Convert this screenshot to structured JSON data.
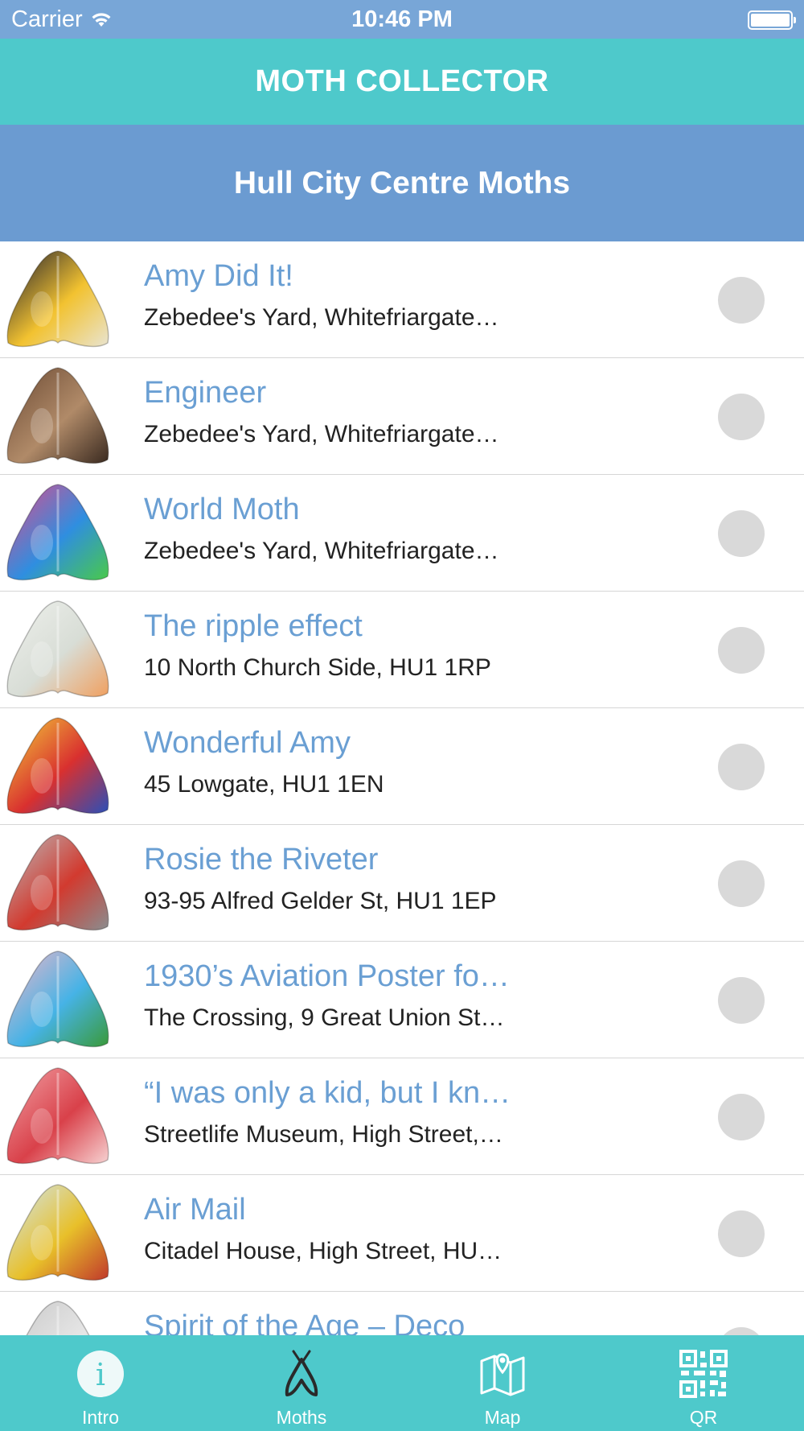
{
  "status": {
    "carrier": "Carrier",
    "time": "10:46 PM"
  },
  "nav": {
    "title": "MOTH COLLECTOR"
  },
  "section": {
    "title": "Hull City Centre Moths"
  },
  "moths": [
    {
      "title": "Amy Did It!",
      "address": "Zebedee's Yard, Whitefriargate…",
      "colors": [
        "#1a1a2e",
        "#f2c230",
        "#e9e4d0"
      ]
    },
    {
      "title": "Engineer",
      "address": "Zebedee's Yard, Whitefriargate…",
      "colors": [
        "#6b4a34",
        "#b08a68",
        "#3a2a20"
      ]
    },
    {
      "title": "World Moth",
      "address": "Zebedee's Yard, Whitefriargate…",
      "colors": [
        "#e24a8a",
        "#2f8ee0",
        "#49c94a"
      ]
    },
    {
      "title": "The ripple effect",
      "address": "10 North Church Side, HU1 1RP",
      "colors": [
        "#eef0ec",
        "#d8ddd6",
        "#f0a060"
      ]
    },
    {
      "title": "Wonderful Amy",
      "address": "45 Lowgate, HU1 1EN",
      "colors": [
        "#f3d03a",
        "#d9302f",
        "#2b4fb8"
      ]
    },
    {
      "title": "Rosie the Riveter",
      "address": "93-95 Alfred Gelder St, HU1 1EP",
      "colors": [
        "#b9bcbe",
        "#d23a2f",
        "#8a8d8f"
      ]
    },
    {
      "title": "1930’s Aviation Poster fo…",
      "address": "The Crossing, 9 Great Union St…",
      "colors": [
        "#f2b6c8",
        "#46b3e6",
        "#3a9a3a"
      ]
    },
    {
      "title": "“I was only a kid, but I kn…",
      "address": "Streetlife Museum, High Street,…",
      "colors": [
        "#f1a2a6",
        "#d9414a",
        "#f7d2d2"
      ]
    },
    {
      "title": "Air Mail",
      "address": "Citadel House, High Street, HU…",
      "colors": [
        "#cfe6f5",
        "#e8c02a",
        "#c0392b"
      ]
    },
    {
      "title": "Spirit of the Age – Deco",
      "address": "",
      "colors": [
        "#c8c8c8",
        "#e6e6e6",
        "#9a9a9a"
      ]
    }
  ],
  "tabs": [
    {
      "label": "Intro",
      "icon": "info-icon"
    },
    {
      "label": "Moths",
      "icon": "moth-icon"
    },
    {
      "label": "Map",
      "icon": "map-icon"
    },
    {
      "label": "QR",
      "icon": "qr-icon"
    }
  ],
  "theme": {
    "status_bar": "#78a6d7",
    "nav_bar": "#4ec9cb",
    "section_header": "#6b9bd1",
    "title_text": "#6a9fd3",
    "check_circle": "#d9d9d9"
  }
}
